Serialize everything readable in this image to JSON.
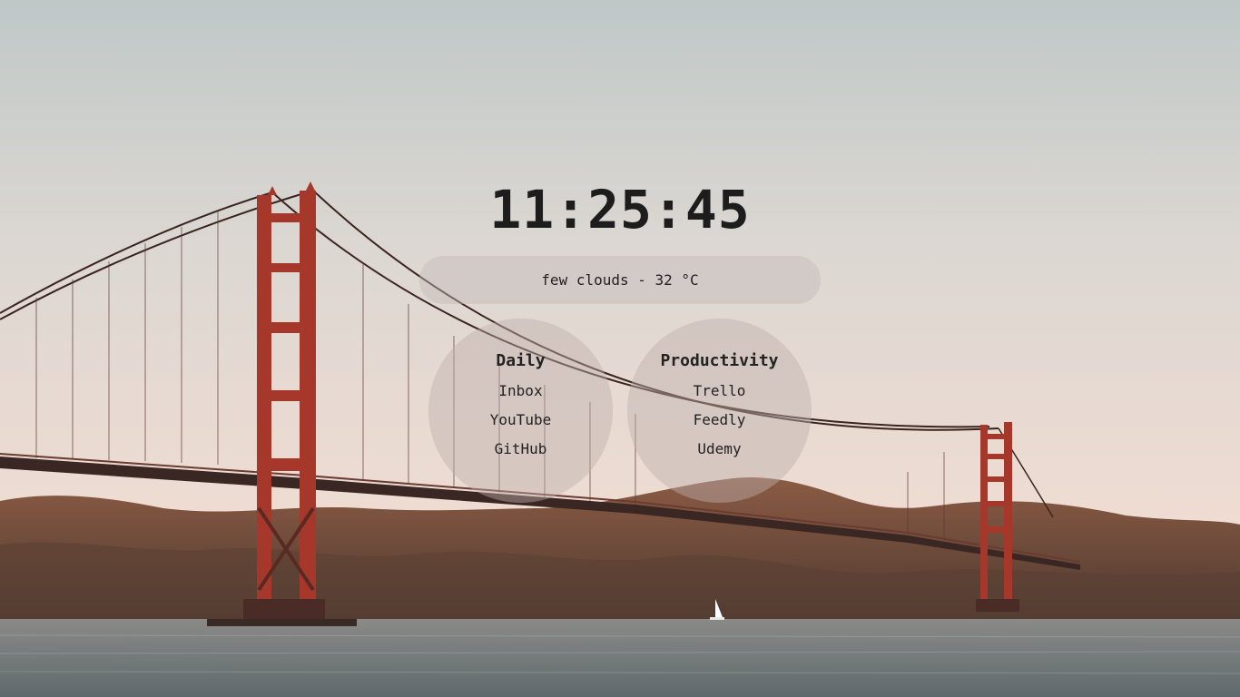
{
  "clock": {
    "time": "11:25:45"
  },
  "weather": {
    "text": "few clouds - 32 °C"
  },
  "groups": [
    {
      "title": "Daily",
      "links": [
        "Inbox",
        "YouTube",
        "GitHub"
      ]
    },
    {
      "title": "Productivity",
      "links": [
        "Trello",
        "Feedly",
        "Udemy"
      ]
    }
  ],
  "background": {
    "subject": "Golden Gate Bridge at sunset",
    "colors": {
      "sky_top": "#c0c9c8",
      "sky_bottom": "#efd9cf",
      "bridge": "#a8382a",
      "hills": "#6a4a3c",
      "water": "#6e7778"
    }
  }
}
